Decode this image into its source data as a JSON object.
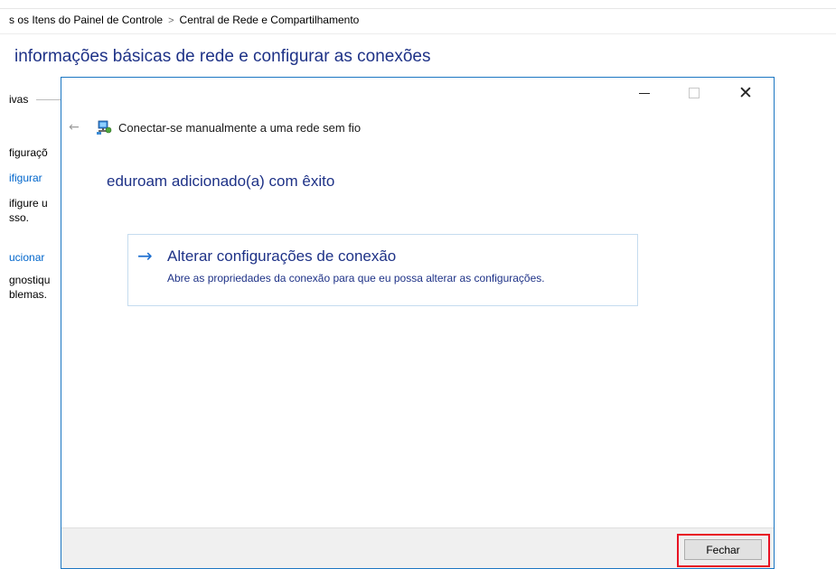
{
  "background_window": {
    "breadcrumb": [
      "s os Itens do Painel de Controle",
      "Central de Rede e Compartilhamento"
    ],
    "breadcrumb_separator": ">",
    "heading": "informações básicas de rede e configurar as conexões",
    "left_texts": {
      "ivas": "ivas",
      "figuracao": "figuraçõ",
      "figurar_link": "ifigurar",
      "figure": "ifigure u",
      "sso": "sso.",
      "ucionar_link": "ucionar",
      "gnostiqu": "gnostiqu",
      "blemas": "blemas."
    }
  },
  "dialog": {
    "titlebar": {
      "minimize_icon": "minimize-icon",
      "maximize_icon": "maximize-icon",
      "close_glyph": "✕"
    },
    "header": {
      "back_glyph": "←",
      "title": "Conectar-se manualmente a uma rede sem fio",
      "icon": "network-wireless-icon"
    },
    "success_message": "eduroam adicionado(a) com êxito",
    "option": {
      "arrow_glyph": "→",
      "title": "Alterar configurações de conexão",
      "description": "Abre as propriedades da conexão para que eu possa alterar as configurações."
    },
    "footer": {
      "close_button_label": "Fechar"
    }
  },
  "colors": {
    "accent_blue": "#1e3287",
    "link_blue": "#0066cc",
    "arrow_blue": "#1e6fd0",
    "highlight_red": "#e81123",
    "window_border": "#1b76c2"
  }
}
